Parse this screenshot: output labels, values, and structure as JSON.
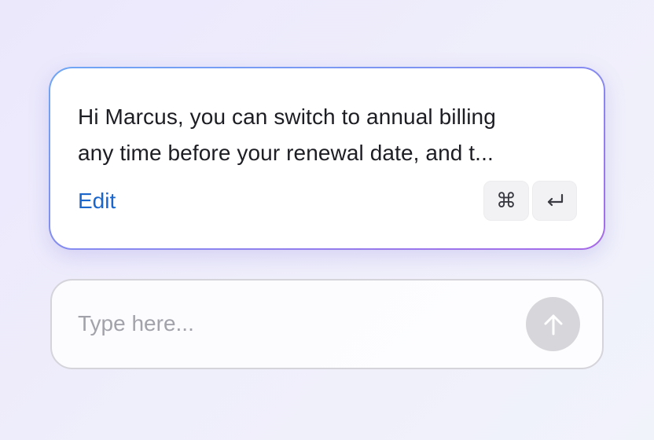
{
  "suggestion": {
    "text": "Hi Marcus, you can switch to annual billing\nany time before your renewal date, and t...",
    "edit_label": "Edit",
    "shortcut_keys": {
      "command_glyph": "⌘",
      "enter_icon": "return-icon"
    }
  },
  "composer": {
    "value": "",
    "placeholder": "Type here...",
    "send_icon": "arrow-up-icon"
  },
  "colors": {
    "accent_link": "#1a66cc",
    "card_border_start": "#6fa6f5",
    "card_border_end": "#a86ae8",
    "send_button_disabled": "#d7d7db"
  }
}
